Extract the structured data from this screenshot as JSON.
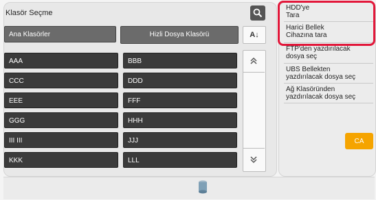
{
  "header": {
    "title": "Klasör Seçme"
  },
  "tabs": {
    "ana": "Ana Klasörler",
    "hizli": "Hizli Dosya Klasörü"
  },
  "sort_label": "A↓",
  "folders": {
    "col1": [
      "AAA",
      "CCC",
      "EEE",
      "GGG",
      "III III",
      "KKK"
    ],
    "col2": [
      "BBB",
      "DDD",
      "FFF",
      "HHH",
      "JJJ",
      "LLL"
    ]
  },
  "right_menu": {
    "hdd": "HDD'ye\nTara",
    "external": "Harici Bellek\nCihazına tara",
    "ftp": "FTP'den yazdırılacak\ndosya seç",
    "usb": "UBS Bellekten\nyazdırılacak dosya seç",
    "network": "Ağ Klasöründen\nyazdırılacak dosya seç"
  },
  "ca_label": "CA",
  "colors": {
    "highlight": "#e2173a",
    "ca": "#f5a400",
    "cell": "#3b3b3b"
  },
  "icons": {
    "search": "search-icon",
    "sort": "sort-az-icon",
    "up": "scroll-up-icon",
    "down": "scroll-down-icon",
    "storage": "storage-icon"
  }
}
